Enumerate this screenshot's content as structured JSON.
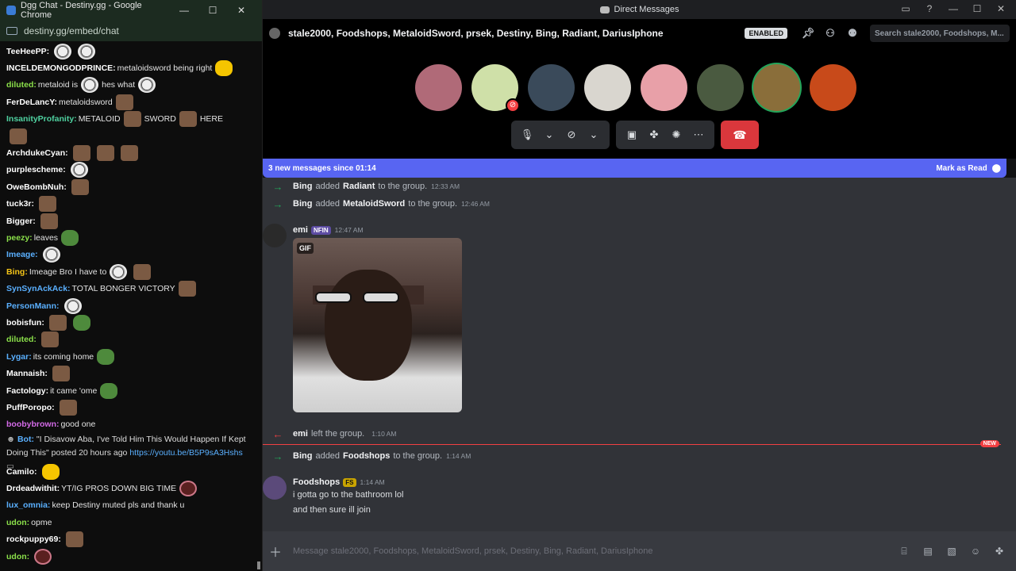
{
  "chrome": {
    "title": "Dgg Chat - Destiny.gg - Google Chrome",
    "url": "destiny.gg/embed/chat",
    "min": "—",
    "max": "☐",
    "close": "✕"
  },
  "chat": {
    "messages": [
      {
        "user": "TeeHeePP",
        "color": "#ffffff",
        "text": "",
        "emotes": [
          "face",
          "face"
        ]
      },
      {
        "user": "INCELDEMONGODPRINCE",
        "color": "#ffffff",
        "text": "metaloidsword being right",
        "emotes": [
          "yellow"
        ]
      },
      {
        "user": "diluted",
        "color": "#8be04a",
        "text": "metaloid is",
        "emotes": [
          "face"
        ],
        "text2": "hes what",
        "emotes2": [
          "face"
        ]
      },
      {
        "user": "FerDeLancY",
        "color": "#ffffff",
        "text": "metaloidsword",
        "emotes": [
          "brown"
        ]
      },
      {
        "user": "InsanityProfanity",
        "color": "#4fd1a0",
        "text": "METALOID",
        "emotes": [
          "brown"
        ],
        "text2": "SWORD",
        "emotes2": [
          "brown"
        ],
        "text3": "HERE"
      },
      {
        "user": "",
        "color": "#ffffff",
        "text": "",
        "emotes": [
          "brown"
        ]
      },
      {
        "user": "ArchdukeCyan",
        "color": "#ffffff",
        "text": "",
        "emotes": [
          "brown",
          "brown",
          "brown"
        ]
      },
      {
        "user": "purplescheme",
        "color": "#ffffff",
        "text": "",
        "emotes": [
          "face"
        ]
      },
      {
        "user": "OweBombNuh",
        "color": "#ffffff",
        "text": "",
        "emotes": [
          "brown"
        ]
      },
      {
        "user": "tuck3r",
        "color": "#ffffff",
        "text": "",
        "emotes": [
          "brown"
        ]
      },
      {
        "user": "Bigger",
        "color": "#ffffff",
        "text": "",
        "emotes": [
          "brown"
        ]
      },
      {
        "user": "peezy",
        "color": "#8be04a",
        "text": "leaves",
        "emotes": [
          "green"
        ]
      },
      {
        "user": "Imeage",
        "color": "#5ab0ff",
        "text": "",
        "emotes": [
          "face"
        ]
      },
      {
        "user": "Bing",
        "color": "#f5c518",
        "text": "Imeage Bro I have to",
        "emotes": [
          "face",
          "brown"
        ]
      },
      {
        "user": "SynSynAckAck",
        "color": "#5ab0ff",
        "text": "TOTAL BONGER VICTORY",
        "emotes": [
          "brown"
        ]
      },
      {
        "user": "PersonMann",
        "color": "#5ab0ff",
        "text": "",
        "emotes": [
          "face"
        ]
      },
      {
        "user": "bobisfun",
        "color": "#ffffff",
        "text": "",
        "emotes": [
          "brown",
          "green"
        ]
      },
      {
        "user": "diluted",
        "color": "#8be04a",
        "text": "",
        "emotes": [
          "brown"
        ]
      },
      {
        "user": "Lygar",
        "color": "#5ab0ff",
        "text": "its coming home",
        "emotes": [
          "green"
        ]
      },
      {
        "user": "Mannaish",
        "color": "#ffffff",
        "text": "",
        "emotes": [
          "brown"
        ]
      },
      {
        "user": "Factology",
        "color": "#ffffff",
        "text": "it came 'ome",
        "emotes": [
          "green"
        ]
      },
      {
        "user": "PuffPoropo",
        "color": "#ffffff",
        "text": "",
        "emotes": [
          "brown"
        ]
      },
      {
        "user": "boobybrown",
        "color": "#d46be8",
        "text": "good one",
        "emotes": []
      }
    ],
    "bot": {
      "user": "Bot",
      "text": "\"I Disavow Aba, I've Told Him This Would Happen If Kept Doing This\" posted 20 hours ago",
      "link": "https://youtu.be/B5P9sA3Hshs"
    },
    "messages2": [
      {
        "user": "Camilo",
        "color": "#ffffff",
        "text": "",
        "emotes": [
          "yellow"
        ]
      },
      {
        "user": "Drdeadwithit",
        "color": "#ffffff",
        "text": "YT/IG PROS DOWN BIG TIME",
        "emotes": [
          "dark"
        ]
      },
      {
        "user": "lux_omnia",
        "color": "#5ab0ff",
        "text": "keep Destiny muted pls and thank u",
        "emotes": []
      },
      {
        "user": "udon",
        "color": "#8be04a",
        "text": "opme",
        "emotes": []
      },
      {
        "user": "rockpuppy69",
        "color": "#ffffff",
        "text": "",
        "emotes": [
          "brown"
        ]
      },
      {
        "user": "udon",
        "color": "#8be04a",
        "text": "",
        "emotes": [
          "dark"
        ]
      }
    ]
  },
  "discord": {
    "window_title": "Direct Messages",
    "channel": "stale2000, Foodshops, MetaloidSword, prsek, Destiny, Bing, Radiant, DariusIphone",
    "enabled_badge": "ENABLED",
    "search_placeholder": "Search stale2000, Foodshops, M...",
    "avatars": [
      {
        "color": "#b06a78",
        "speaking": false,
        "muted": false
      },
      {
        "color": "#cfe0a8",
        "speaking": false,
        "muted": true
      },
      {
        "color": "#3a4a5a",
        "speaking": false,
        "muted": false
      },
      {
        "color": "#d9d6cf",
        "speaking": false,
        "muted": false
      },
      {
        "color": "#e8a0a8",
        "speaking": false,
        "muted": false
      },
      {
        "color": "#4a5a40",
        "speaking": false,
        "muted": false
      },
      {
        "color": "#8a6e3a",
        "speaking": true,
        "muted": false
      },
      {
        "color": "#c84a1a",
        "speaking": false,
        "muted": false
      }
    ],
    "new_messages": "3 new messages since 01:14",
    "mark_read": "Mark as Read",
    "sys1": {
      "actor": "Bing",
      "mid": "added",
      "target": "Radiant",
      "tail": "to the group.",
      "time": "12:33 AM"
    },
    "sys2": {
      "actor": "Bing",
      "mid": "added",
      "target": "MetaloidSword",
      "tail": "to the group.",
      "time": "12:46 AM"
    },
    "post1": {
      "name": "emi",
      "tag": "NFIN",
      "time": "12:47 AM",
      "gif_label": "GIF"
    },
    "sys3": {
      "actor": "emi",
      "mid": "left the group.",
      "time": "1:10 AM"
    },
    "new_tag": "NEW",
    "sys4": {
      "actor": "Bing",
      "mid": "added",
      "target": "Foodshops",
      "tail": "to the group.",
      "time": "1:14 AM"
    },
    "post2": {
      "name": "Foodshops",
      "tag": "FS",
      "time": "1:14 AM",
      "line1": "i gotta go to the bathroom lol",
      "line2": "and then sure ill join"
    },
    "composer_placeholder": "Message stale2000, Foodshops, MetaloidSword, prsek, Destiny, Bing, Radiant, DariusIphone"
  }
}
